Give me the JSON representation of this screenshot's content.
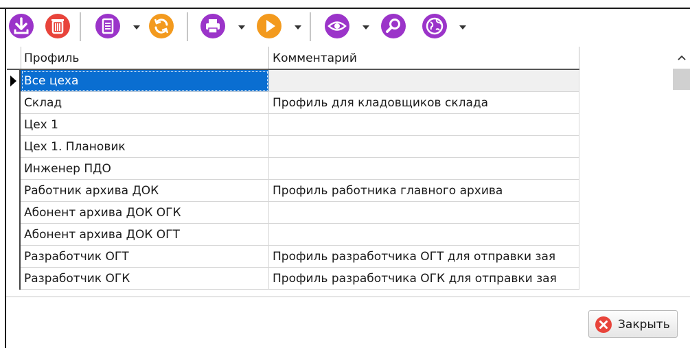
{
  "toolbar": {
    "buttons": [
      {
        "icon": "download-icon",
        "color": "#9b34c9"
      },
      {
        "icon": "trash-icon",
        "color": "#e8443b"
      },
      {
        "icon": "document-icon",
        "color": "#9b34c9"
      },
      {
        "icon": "refresh-icon",
        "color": "#f39a1e"
      },
      {
        "icon": "printer-icon",
        "color": "#9b34c9"
      },
      {
        "icon": "play-icon",
        "color": "#f39a1e"
      },
      {
        "icon": "eye-icon",
        "color": "#9b34c9"
      },
      {
        "icon": "search-icon",
        "color": "#9b34c9"
      },
      {
        "icon": "globe-icon",
        "color": "#9b34c9"
      }
    ]
  },
  "grid": {
    "columns": [
      "Профиль",
      "Комментарий"
    ],
    "rows": [
      {
        "profile": "Все цеха",
        "comment": ""
      },
      {
        "profile": "Склад",
        "comment": "Профиль для кладовщиков склада"
      },
      {
        "profile": "Цех 1",
        "comment": ""
      },
      {
        "profile": "Цех 1. Плановик",
        "comment": ""
      },
      {
        "profile": "Инженер ПДО",
        "comment": ""
      },
      {
        "profile": "Работник архива ДОК",
        "comment": "Профиль работника главного архива"
      },
      {
        "profile": "Абонент архива ДОК ОГК",
        "comment": ""
      },
      {
        "profile": "Абонент архива ДОК ОГТ",
        "comment": ""
      },
      {
        "profile": "Разработчик ОГТ",
        "comment": "Профиль разработчика ОГТ для отправки зая"
      },
      {
        "profile": "Разработчик ОГК",
        "comment": "Профиль разработчика ОГК для отправки зая"
      }
    ],
    "selected_row": 0,
    "selection_color": "#0a6ed1"
  },
  "footer": {
    "close_label": "Закрыть",
    "close_icon": "close-circle-icon",
    "close_icon_color": "#e8443b"
  }
}
